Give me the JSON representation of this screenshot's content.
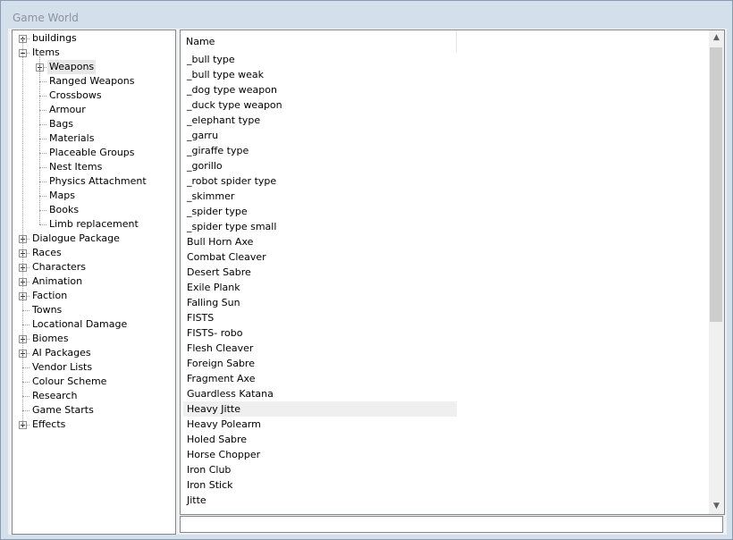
{
  "window": {
    "title": "Game World"
  },
  "tree": [
    {
      "label": "buildings",
      "level": 0,
      "expander": "plus"
    },
    {
      "label": "Items",
      "level": 0,
      "expander": "minus"
    },
    {
      "label": "Weapons",
      "level": 1,
      "expander": "plus",
      "selected": true
    },
    {
      "label": "Ranged Weapons",
      "level": 1
    },
    {
      "label": "Crossbows",
      "level": 1
    },
    {
      "label": "Armour",
      "level": 1
    },
    {
      "label": "Bags",
      "level": 1
    },
    {
      "label": "Materials",
      "level": 1
    },
    {
      "label": "Placeable Groups",
      "level": 1
    },
    {
      "label": "Nest Items",
      "level": 1
    },
    {
      "label": "Physics Attachment",
      "level": 1
    },
    {
      "label": "Maps",
      "level": 1
    },
    {
      "label": "Books",
      "level": 1
    },
    {
      "label": "Limb replacement",
      "level": 1
    },
    {
      "label": "Dialogue Package",
      "level": 0,
      "expander": "plus"
    },
    {
      "label": "Races",
      "level": 0,
      "expander": "plus"
    },
    {
      "label": "Characters",
      "level": 0,
      "expander": "plus"
    },
    {
      "label": "Animation",
      "level": 0,
      "expander": "plus"
    },
    {
      "label": "Faction",
      "level": 0,
      "expander": "plus"
    },
    {
      "label": "Towns",
      "level": 0
    },
    {
      "label": "Locational Damage",
      "level": 0
    },
    {
      "label": "Biomes",
      "level": 0,
      "expander": "plus"
    },
    {
      "label": "AI Packages",
      "level": 0,
      "expander": "plus"
    },
    {
      "label": "Vendor Lists",
      "level": 0
    },
    {
      "label": "Colour Scheme",
      "level": 0
    },
    {
      "label": "Research",
      "level": 0
    },
    {
      "label": "Game Starts",
      "level": 0
    },
    {
      "label": "Effects",
      "level": 0,
      "expander": "plus"
    }
  ],
  "list": {
    "column_header": "Name",
    "highlighted_item": "Heavy Jitte",
    "items": [
      "_bull type",
      "_bull type weak",
      "_dog type weapon",
      "_duck type weapon",
      "_elephant type",
      "_garru",
      "_giraffe type",
      "_gorillo",
      "_robot spider type",
      "_skimmer",
      "_spider type",
      "_spider type small",
      "Bull Horn Axe",
      "Combat Cleaver",
      "Desert Sabre",
      "Exile Plank",
      "Falling Sun",
      "FISTS",
      "FISTS- robo",
      "Flesh Cleaver",
      "Foreign Sabre",
      "Fragment Axe",
      "Guardless Katana",
      "Heavy Jitte",
      "Heavy Polearm",
      "Holed Sabre",
      "Horse Chopper",
      "Iron Club",
      "Iron Stick",
      "Jitte"
    ]
  },
  "scrollbar": {
    "up_glyph": "▲",
    "down_glyph": "▼",
    "position": 0.0
  },
  "status_text": ""
}
